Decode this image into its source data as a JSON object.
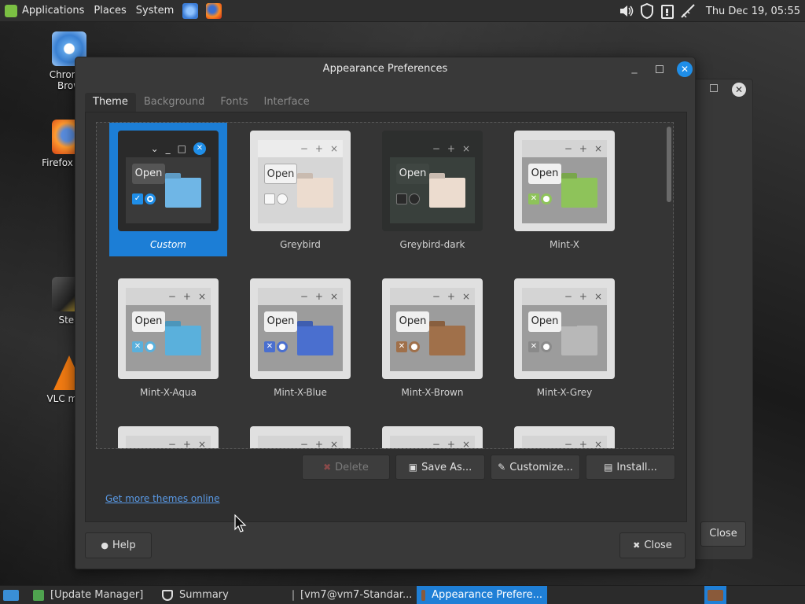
{
  "top_panel": {
    "menus": [
      "Applications",
      "Places",
      "System"
    ],
    "clock": "Thu Dec 19, 05:55"
  },
  "desktop_icons": [
    {
      "label": "Chromiu\nBrow"
    },
    {
      "label": "Firefox Web"
    },
    {
      "label": "Stea"
    },
    {
      "label": "VLC medi"
    }
  ],
  "background_dialog": {
    "close_label": "Close"
  },
  "window": {
    "title": "Appearance Preferences",
    "tabs": [
      "Theme",
      "Background",
      "Fonts",
      "Interface"
    ],
    "themes": [
      {
        "name": "Custom"
      },
      {
        "name": "Greybird"
      },
      {
        "name": "Greybird-dark"
      },
      {
        "name": "Mint-X"
      },
      {
        "name": "Mint-X-Aqua"
      },
      {
        "name": "Mint-X-Blue"
      },
      {
        "name": "Mint-X-Brown"
      },
      {
        "name": "Mint-X-Grey"
      }
    ],
    "preview_open_label": "Open",
    "buttons": {
      "delete": "Delete",
      "save_as": "Save As...",
      "customize": "Customize...",
      "install": "Install..."
    },
    "more_themes_link": "Get more themes online",
    "help_label": "Help",
    "close_label": "Close"
  },
  "taskbar": [
    {
      "label": "[Update Manager]"
    },
    {
      "label": "Summary"
    },
    {
      "label": "[vm7@vm7-Standar..."
    },
    {
      "label": "Appearance Prefere..."
    }
  ],
  "colors": {
    "accent": "#1c7ed6",
    "link": "#5a9ae6"
  }
}
